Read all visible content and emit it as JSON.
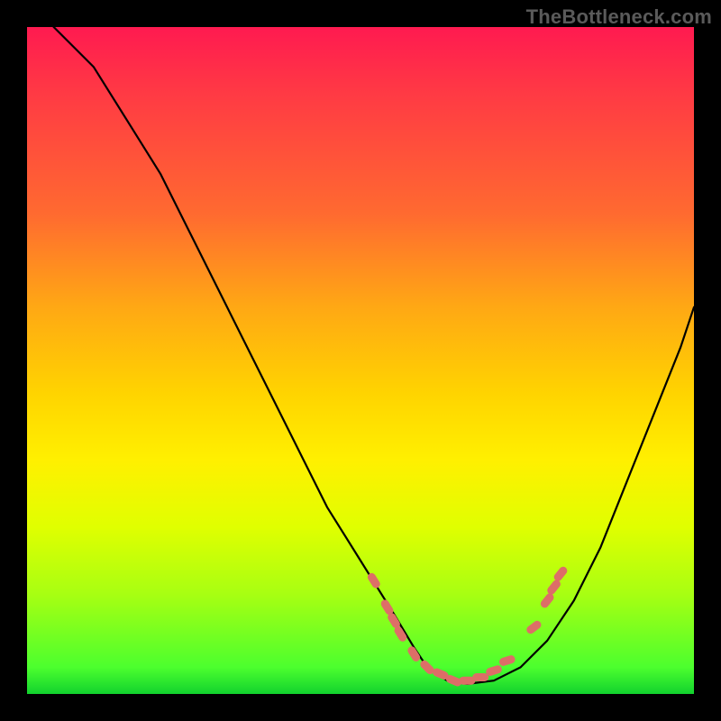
{
  "watermark": "TheBottleneck.com",
  "chart_data": {
    "type": "line",
    "title": "",
    "xlabel": "",
    "ylabel": "",
    "xlim": [
      0,
      100
    ],
    "ylim": [
      0,
      100
    ],
    "series": [
      {
        "name": "bottleneck-curve",
        "x": [
          4,
          10,
          15,
          20,
          25,
          30,
          35,
          40,
          45,
          50,
          55,
          58,
          60,
          63,
          66,
          70,
          74,
          78,
          82,
          86,
          90,
          94,
          98,
          100
        ],
        "y": [
          100,
          94,
          86,
          78,
          68,
          58,
          48,
          38,
          28,
          20,
          12,
          7,
          4,
          2,
          1.5,
          2,
          4,
          8,
          14,
          22,
          32,
          42,
          52,
          58
        ]
      }
    ],
    "markers": {
      "name": "highlighted-points",
      "color": "#dd6e67",
      "points": [
        {
          "x": 52,
          "y": 17
        },
        {
          "x": 54,
          "y": 13
        },
        {
          "x": 55,
          "y": 11
        },
        {
          "x": 56,
          "y": 9
        },
        {
          "x": 58,
          "y": 6
        },
        {
          "x": 60,
          "y": 4
        },
        {
          "x": 62,
          "y": 3
        },
        {
          "x": 64,
          "y": 2
        },
        {
          "x": 66,
          "y": 2
        },
        {
          "x": 68,
          "y": 2.5
        },
        {
          "x": 70,
          "y": 3.5
        },
        {
          "x": 72,
          "y": 5
        },
        {
          "x": 76,
          "y": 10
        },
        {
          "x": 78,
          "y": 14
        },
        {
          "x": 79,
          "y": 16
        },
        {
          "x": 80,
          "y": 18
        }
      ]
    },
    "background_gradient": {
      "top": "#ff1a50",
      "middle": "#fff000",
      "bottom": "#12d22e"
    }
  }
}
